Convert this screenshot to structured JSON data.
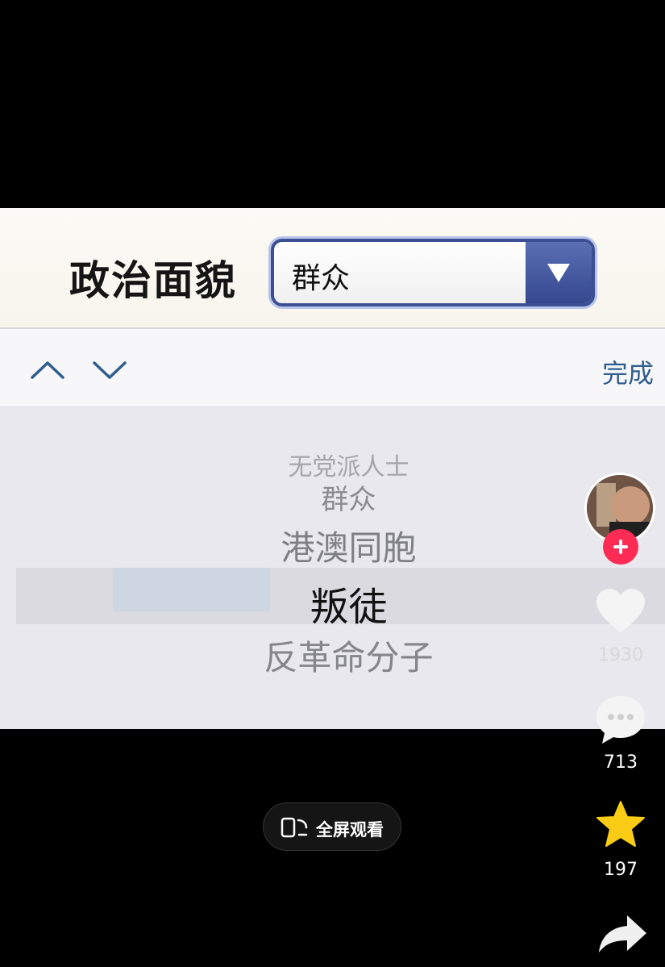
{
  "form": {
    "label": "政治面貌",
    "selected_value": "群众"
  },
  "toolbar": {
    "done_label": "完成"
  },
  "picker": {
    "items": [
      "无党派人士",
      "群众",
      "港澳同胞",
      "叛徒",
      "反革命分子"
    ],
    "selected_index": 3
  },
  "actions": {
    "like_count": "1930",
    "comment_count": "713",
    "favorite_count": "197"
  },
  "fullscreen": {
    "label": "全屏观看"
  },
  "icons": {
    "nav_up": "chevron-up-icon",
    "nav_down": "chevron-down-icon",
    "dropdown": "triangle-down-icon",
    "like": "heart-icon",
    "comment": "comment-icon",
    "favorite": "star-icon",
    "share": "share-icon",
    "follow": "plus-icon",
    "fullscreen": "phone-rotate-icon"
  },
  "colors": {
    "accent_red": "#fe2c55",
    "favorite_yellow": "#facc15",
    "select_blue": "#3c4f95",
    "done_blue": "#2f5d8e"
  }
}
